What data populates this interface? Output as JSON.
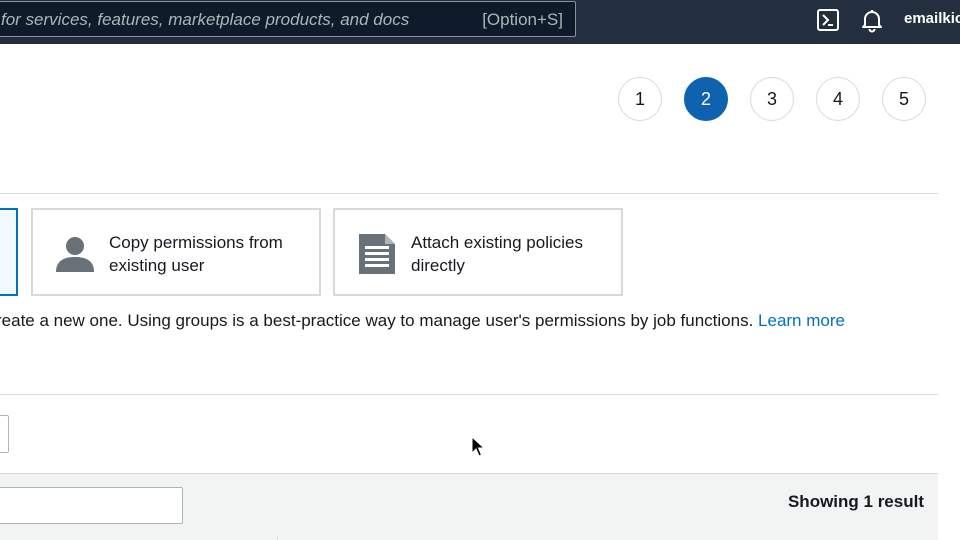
{
  "header": {
    "search_placeholder": "for services, features, marketplace products, and docs",
    "search_shortcut": "[Option+S]",
    "account_name": "emailkic",
    "icons": [
      "cloudshell-icon",
      "bell-icon"
    ]
  },
  "wizard": {
    "steps": [
      "1",
      "2",
      "3",
      "4",
      "5"
    ],
    "active_step": "2"
  },
  "permissions": {
    "options": [
      {
        "label": "Copy permissions from existing user",
        "icon": "user-icon"
      },
      {
        "label": "Attach existing policies directly",
        "icon": "document-icon"
      }
    ],
    "description": "reate a new one. Using groups is a best-practice way to manage user's permissions by job functions.",
    "learn_more": "Learn more"
  },
  "table": {
    "result_count_text": "Showing 1 result"
  },
  "colors": {
    "topbar": "#232f3e",
    "accent": "#0073bb",
    "active_step": "#0f62b0"
  }
}
